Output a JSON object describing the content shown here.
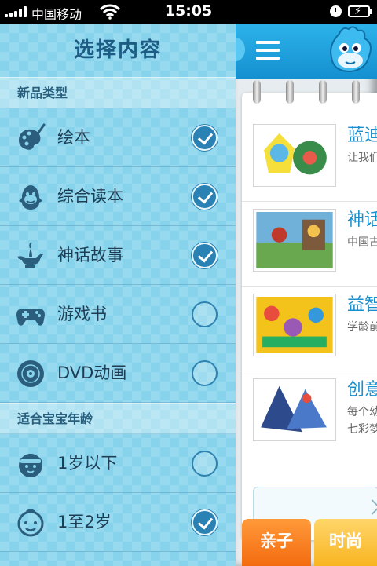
{
  "status_bar": {
    "carrier": "中国移动",
    "time": "15:05"
  },
  "menu": {
    "title": "选择内容",
    "sections": [
      {
        "header": "新品类型",
        "items": [
          {
            "label": "绘本",
            "icon": "palette-icon",
            "checked": true
          },
          {
            "label": "综合读本",
            "icon": "character-head-icon",
            "checked": true
          },
          {
            "label": "神话故事",
            "icon": "magic-lamp-icon",
            "checked": true
          },
          {
            "label": "游戏书",
            "icon": "gamepad-icon",
            "checked": false
          },
          {
            "label": "DVD动画",
            "icon": "dvd-disc-icon",
            "checked": false
          }
        ]
      },
      {
        "header": "适合宝宝年龄",
        "items": [
          {
            "label": "1岁以下",
            "icon": "baby-face-icon",
            "checked": false
          },
          {
            "label": "1至2岁",
            "icon": "toddler-face-icon",
            "checked": true
          }
        ]
      }
    ]
  },
  "content": {
    "books": [
      {
        "title": "蓝迪",
        "desc": [
          "让我们"
        ]
      },
      {
        "title": "神话",
        "desc": [
          "中国古"
        ]
      },
      {
        "title": "益智",
        "desc": [
          "学龄前"
        ]
      },
      {
        "title": "创意",
        "desc": [
          "每个幼",
          "七彩梦"
        ]
      }
    ],
    "tabs": [
      "亲子",
      "时尚"
    ]
  },
  "colors": {
    "menu_bg": "#87d3ec",
    "header_blue": "#1a9ad8",
    "check_on": "#2a82b4",
    "tab_orange": "#f36b0f",
    "tab_yellow": "#f8b521",
    "title_blue": "#1a8fcd"
  }
}
